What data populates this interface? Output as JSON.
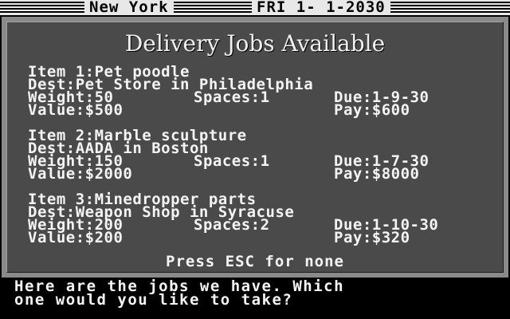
{
  "status_bar": {
    "location": "New York",
    "date": "FRI 1- 1-2030"
  },
  "panel": {
    "title": "Delivery Jobs Available",
    "jobs": [
      {
        "item": "Item 1:Pet poodle",
        "dest": "Dest:Pet Store in Philadelphia",
        "weight": "Weight:50",
        "spaces": "Spaces:1",
        "due": "Due:1-9-30",
        "value": "Value:$500",
        "pay": "Pay:$600"
      },
      {
        "item": "Item 2:Marble sculpture",
        "dest": "Dest:AADA in Boston",
        "weight": "Weight:150",
        "spaces": "Spaces:1",
        "due": "Due:1-7-30",
        "value": "Value:$2000",
        "pay": "Pay:$8000"
      },
      {
        "item": "Item 3:Minedropper parts",
        "dest": "Dest:Weapon Shop in Syracuse",
        "weight": "Weight:200",
        "spaces": "Spaces:2",
        "due": "Due:1-10-30",
        "value": "Value:$200",
        "pay": "Pay:$320"
      }
    ],
    "hint": "Press ESC for none"
  },
  "message": {
    "line1": "Here are the jobs we have. Which",
    "line2": "one would you like to take?"
  },
  "colors": {
    "title_bar_bg": "#e8e8e8",
    "frame_bg": "#8a8a8a",
    "panel_bg": "#4a4a4a",
    "text": "#f4f4f4",
    "message_bg": "#000000"
  }
}
